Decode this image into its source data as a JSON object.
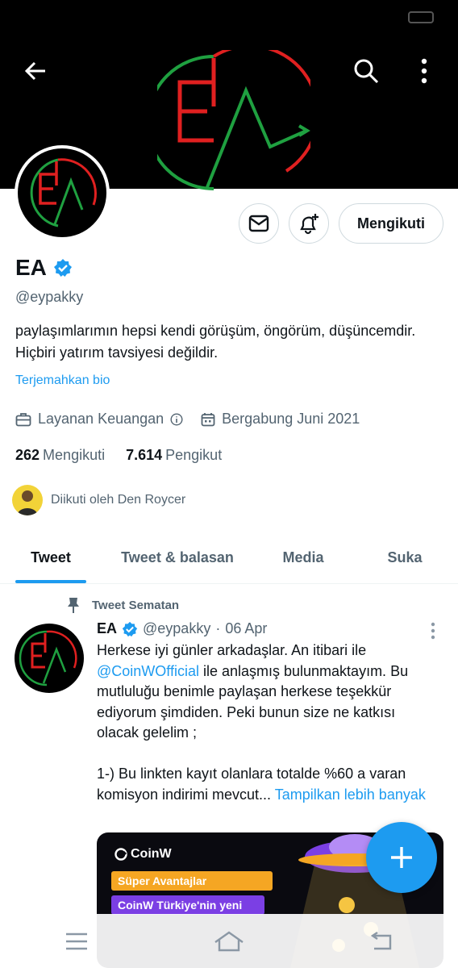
{
  "profile": {
    "name": "EA",
    "handle": "@eypakky",
    "bio": "paylaşımlarımın hepsi kendi görüşüm, öngörüm, düşüncemdir. Hiçbiri yatırım tavsiyesi değildir.",
    "translate_bio": "Terjemahkan bio",
    "category": "Layanan Keuangan",
    "joined": "Bergabung Juni 2021",
    "following_count": "262",
    "following_label": "Mengikuti",
    "followers_count": "7.614",
    "followers_label": "Pengikut",
    "followed_by": "Diikuti oleh Den Roycer",
    "follow_button": "Mengikuti"
  },
  "tabs": [
    {
      "label": "Tweet",
      "active": true
    },
    {
      "label": "Tweet & balasan",
      "active": false
    },
    {
      "label": "Media",
      "active": false
    },
    {
      "label": "Suka",
      "active": false
    }
  ],
  "tweet": {
    "pinned_label": "Tweet Sematan",
    "author_name": "EA",
    "author_handle": "@eypakky",
    "date": "06 Apr",
    "text_part1": "Herkese iyi günler arkadaşlar. An itibari ile ",
    "mention": "@CoinWOfficial",
    "text_part2": " ile anlaşmış bulunmaktayım. Bu mutluluğu benimle paylaşan herkese teşekkür ediyorum şimdiden. Peki bunun size ne katkısı olacak gelelim ;\n\n1-) Bu linkten kayıt olanlara totalde %60 a varan komisyon indirimi mevcut... ",
    "show_more": "Tampilkan lebih banyak",
    "card_brand": "CoinW",
    "card_line1": "Süper Avantajlar",
    "card_line2": "CoinW Türkiye'nin yeni"
  },
  "colors": {
    "accent": "#1d9bf0",
    "banner_bg": "#000000",
    "logo_red": "#e02020",
    "logo_green": "#1fa040"
  },
  "icons": {
    "back": "arrow-left-icon",
    "search": "search-icon",
    "more": "more-vertical-icon",
    "message": "envelope-icon",
    "notify": "bell-plus-icon",
    "verified": "verified-badge-icon",
    "info": "info-icon",
    "category": "briefcase-icon",
    "calendar": "calendar-icon",
    "pin": "pin-icon",
    "compose": "plus-icon",
    "menu": "menu-icon",
    "home": "home-icon",
    "back_sys": "return-icon"
  }
}
